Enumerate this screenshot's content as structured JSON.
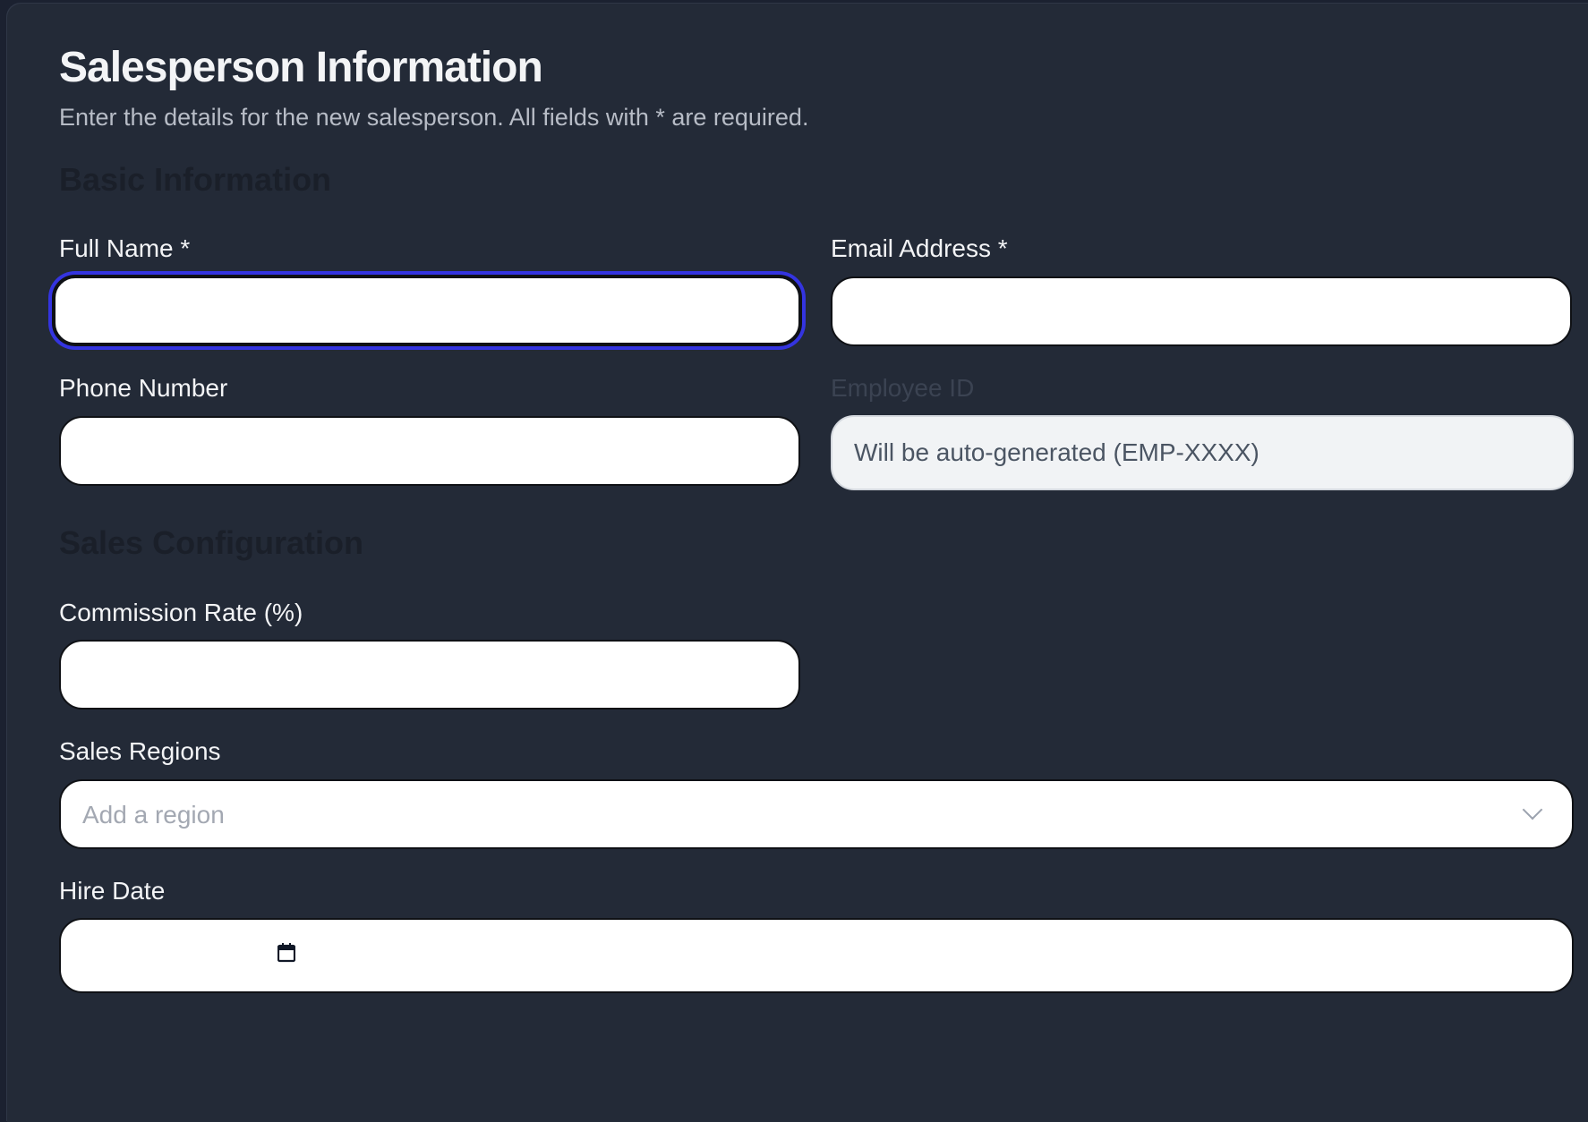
{
  "header": {
    "title": "Salesperson Information",
    "subtitle": "Enter the details for the new salesperson. All fields with * are required."
  },
  "sections": {
    "basic": "Basic Information",
    "sales": "Sales Configuration"
  },
  "fields": {
    "full_name": {
      "label": "Full Name *",
      "value": "",
      "placeholder": ""
    },
    "email": {
      "label": "Email Address *",
      "value": "",
      "placeholder": ""
    },
    "phone": {
      "label": "Phone Number",
      "value": "",
      "placeholder": ""
    },
    "employee_id": {
      "label": "Employee ID",
      "value": "",
      "placeholder": "Will be auto-generated (EMP-XXXX)"
    },
    "commission_rate": {
      "label": "Commission Rate (%)",
      "value": "",
      "placeholder": ""
    },
    "sales_regions": {
      "label": "Sales Regions",
      "placeholder": "Add a region"
    },
    "hire_date": {
      "label": "Hire Date",
      "value": ""
    }
  },
  "icons": {
    "regions_dropdown": "chevron-down-icon",
    "hire_date_picker": "calendar-icon"
  },
  "colors": {
    "background": "#232a37",
    "focus_ring": "#3434e0",
    "text_primary": "#f3f4f6",
    "text_muted": "#b7bcc6"
  }
}
